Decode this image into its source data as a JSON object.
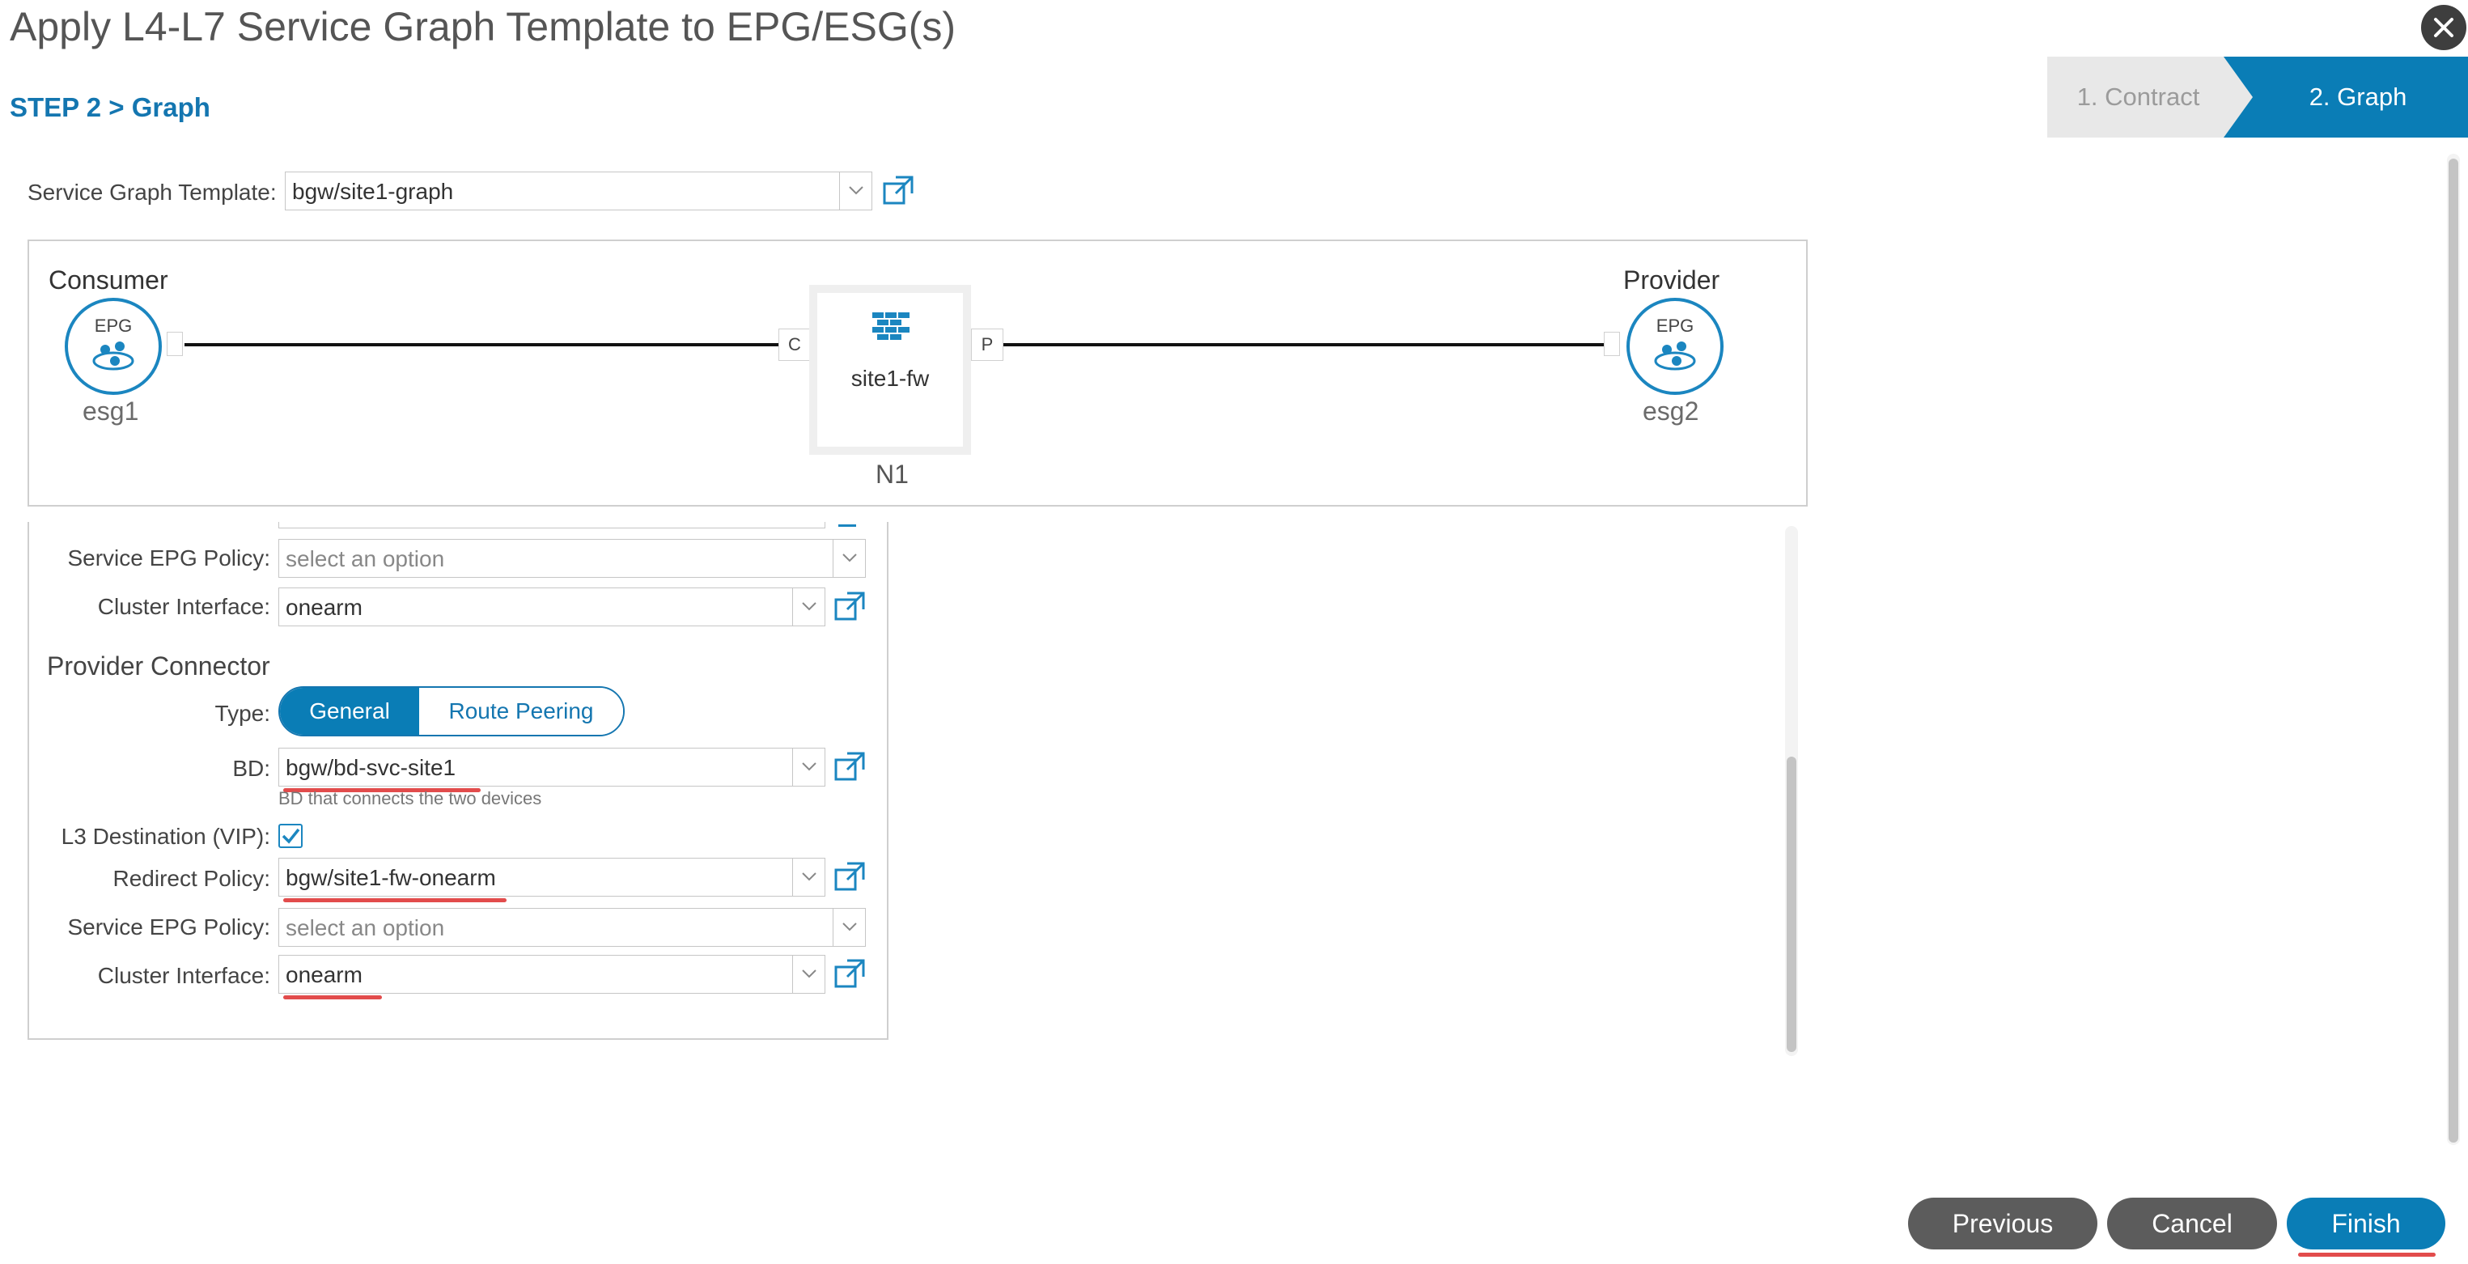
{
  "dialog": {
    "title": "Apply L4-L7 Service Graph Template to EPG/ESG(s)",
    "step_label": "STEP 2 > Graph"
  },
  "wizard": {
    "steps": [
      "1. Contract",
      "2. Graph"
    ],
    "active_step": "2. Graph"
  },
  "template": {
    "label": "Service Graph Template:",
    "value": "bgw/site1-graph"
  },
  "graph": {
    "consumer": {
      "label": "Consumer",
      "badge": "EPG",
      "name": "esg1"
    },
    "provider": {
      "label": "Provider",
      "badge": "EPG",
      "name": "esg2"
    },
    "node": {
      "name": "site1-fw",
      "id": "N1",
      "consumer_conn": "C",
      "provider_conn": "P"
    }
  },
  "consumer_partial": {
    "service_epg_policy": {
      "label": "Service EPG Policy:",
      "placeholder": "select an option"
    },
    "cluster_interface": {
      "label": "Cluster Interface:",
      "value": "onearm"
    }
  },
  "provider_connector": {
    "title": "Provider Connector",
    "type": {
      "label": "Type:",
      "options": [
        "General",
        "Route Peering"
      ],
      "selected": "General"
    },
    "bd": {
      "label": "BD:",
      "value": "bgw/bd-svc-site1",
      "help": "BD that connects the two devices"
    },
    "l3_destination": {
      "label": "L3 Destination (VIP):",
      "checked": true
    },
    "redirect_policy": {
      "label": "Redirect Policy:",
      "value": "bgw/site1-fw-onearm"
    },
    "service_epg_policy": {
      "label": "Service EPG Policy:",
      "placeholder": "select an option"
    },
    "cluster_interface": {
      "label": "Cluster Interface:",
      "value": "onearm"
    }
  },
  "footer": {
    "previous": "Previous",
    "cancel": "Cancel",
    "finish": "Finish"
  },
  "colors": {
    "accent": "#0a7db6",
    "highlight_underline": "#e24c4c",
    "secondary_button": "#5c5c5c"
  }
}
